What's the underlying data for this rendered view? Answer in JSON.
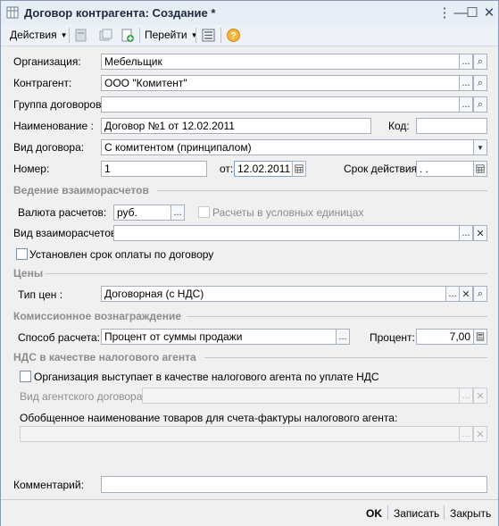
{
  "window": {
    "title": "Договор контрагента: Создание *"
  },
  "toolbar": {
    "actions": "Действия",
    "goto": "Перейти"
  },
  "form": {
    "organization_label": "Организация:",
    "organization_value": "Мебельщик",
    "counterparty_label": "Контрагент:",
    "counterparty_value": "ООО \"Комитент\"",
    "group_label": "Группа договоров:",
    "group_value": "",
    "name_label": "Наименование :",
    "name_value": "Договор №1 от 12.02.2011",
    "code_label": "Код:",
    "code_value": "",
    "kind_label": "Вид договора:",
    "kind_value": "С комитентом (принципалом)",
    "number_label": "Номер:",
    "number_value": "1",
    "from_label": "от:",
    "date_value": "12.02.2011",
    "validity_label": "Срок действия:",
    "validity_value": " .  .",
    "section_settlements": "Ведение взаиморасчетов",
    "currency_label": "Валюта расчетов:",
    "currency_value": "руб.",
    "cond_units_label": "Расчеты в условных единицах",
    "settle_kind_label": "Вид взаиморасчетов:",
    "settle_kind_value": "",
    "payment_term_label": "Установлен срок оплаты по договору",
    "section_prices": "Цены",
    "price_type_label": "Тип цен :",
    "price_type_value": "Договорная (с НДС)",
    "section_commission": "Комиссионное вознаграждение",
    "calc_method_label": "Способ расчета:",
    "calc_method_value": "Процент от суммы продажи",
    "percent_label": "Процент:",
    "percent_value": "7,00",
    "section_vat": "НДС в качестве налогового агента",
    "vat_agent_label": "Организация выступает в качестве налогового агента по уплате НДС",
    "agent_contract_label": "Вид агентского договора:",
    "agent_contract_value": "",
    "goods_name_label": "Обобщенное наименование товаров для счета-фактуры налогового агента:",
    "goods_name_value": "",
    "comment_label": "Комментарий:",
    "comment_value": ""
  },
  "footer": {
    "ok": "OK",
    "save": "Записать",
    "close": "Закрыть"
  },
  "glyphs": {
    "dots": "...",
    "search": "⌕",
    "clear": "✕",
    "dropdown": "▼",
    "minimize": "—",
    "maximize": "☐",
    "close": "✕",
    "help": "?"
  }
}
